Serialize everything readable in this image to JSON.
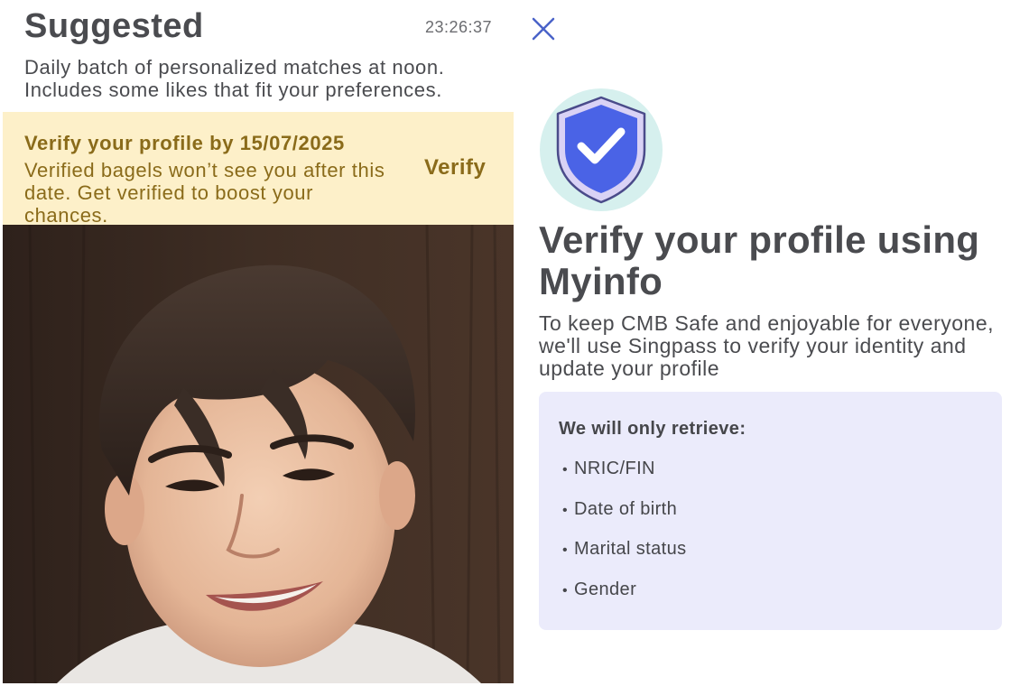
{
  "header": {
    "title": "Suggested",
    "timestamp": "23:26:37",
    "subtitle": "Daily batch of personalized matches at noon. Includes some likes that fit your preferences."
  },
  "banner": {
    "title": "Verify your profile by 15/07/2025",
    "body": "Verified bagels won’t see you after this date. Get verified to boost your chances.",
    "action": "Verify"
  },
  "verify_panel": {
    "heading": "Verify your profile using Myinfo",
    "description": "To keep CMB Safe and enjoyable for everyone, we'll use Singpass to verify your identity and update your profile",
    "retrieve_heading": "We will only retrieve:",
    "items": [
      "NRIC/FIN",
      "Date of birth",
      "Marital status",
      "Gender"
    ],
    "bullet": "•"
  },
  "icons": {
    "close": "close-icon",
    "shield": "shield-check-icon"
  },
  "colors": {
    "banner_bg": "#fdf0c9",
    "banner_text": "#8a6b1a",
    "info_bg": "#ebebfb",
    "close_icon": "#4a63c8",
    "shield_fill": "#4a63e6"
  }
}
